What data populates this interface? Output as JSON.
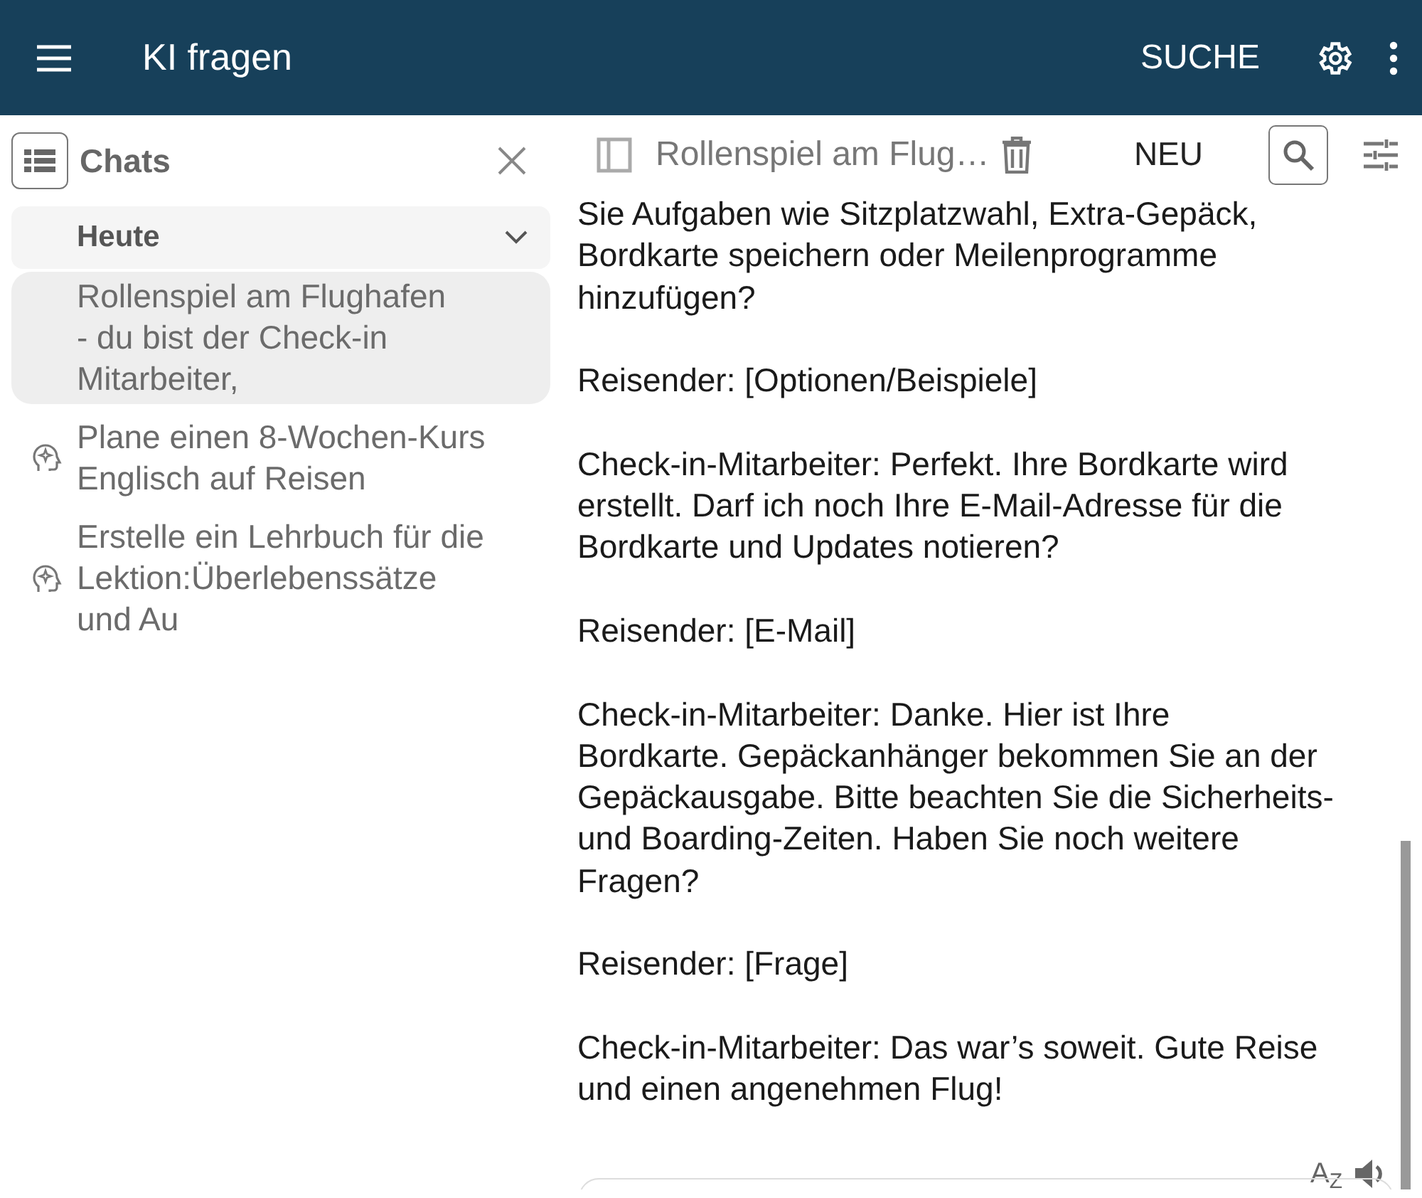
{
  "app_bar": {
    "title": "KI fragen",
    "search_label": "SUCHE"
  },
  "sidebar": {
    "title": "Chats",
    "groups": [
      {
        "label": "Heute",
        "expanded": true,
        "items": [
          {
            "lines": [
              "Rollenspiel am Flughafen",
              "- du bist der Check-in",
              "Mitarbeiter,"
            ],
            "selected": true,
            "kind": "plain"
          },
          {
            "lines": [
              "Plane einen 8-Wochen-Kurs",
              "Englisch auf Reisen"
            ],
            "selected": false,
            "kind": "ai"
          },
          {
            "lines": [
              "Erstelle ein Lehrbuch für die",
              "Lektion:Überlebenssätze",
              "und Au"
            ],
            "selected": false,
            "kind": "ai"
          }
        ]
      }
    ]
  },
  "chat_toolbar": {
    "title": "Rollenspiel am Flug…",
    "new_label": "NEU"
  },
  "message": {
    "paragraphs": [
      [
        "Sie Aufgaben wie Sitzplatzwahl, Extra-Gepäck,",
        "Bordkarte speichern oder Meilenprogramme",
        "hinzufügen?"
      ],
      [
        "Reisender: [Optionen/Beispiele]"
      ],
      [
        "Check-in-Mitarbeiter: Perfekt. Ihre Bordkarte wird",
        "erstellt. Darf ich noch Ihre E-Mail-Adresse für die",
        "Bordkarte und Updates notieren?"
      ],
      [
        "Reisender: [E-Mail]"
      ],
      [
        "Check-in-Mitarbeiter: Danke. Hier ist Ihre",
        "Bordkarte. Gepäckanhänger bekommen Sie an der",
        "Gepäckausgabe. Bitte beachten Sie die Sicherheits-",
        "und Boarding-Zeiten. Haben Sie noch weitere",
        "Fragen?"
      ],
      [
        "Reisender: [Frage]"
      ],
      [
        "Check-in-Mitarbeiter: Das war’s soweit. Gute Reise",
        "und einen angenehmen Flug!"
      ]
    ],
    "translate_label": "A$_{Z}$"
  }
}
